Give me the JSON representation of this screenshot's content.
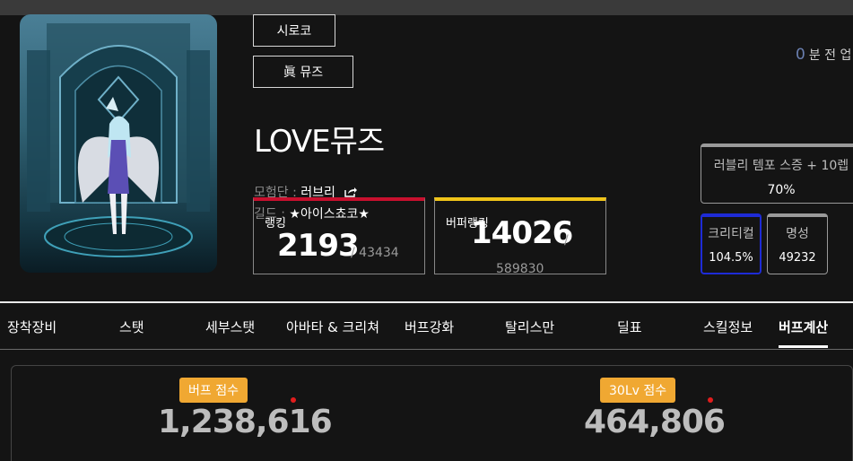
{
  "character": {
    "server": "시로코",
    "job": "眞 뮤즈",
    "name": "LOVE뮤즈",
    "adventure_label": "모험단 : ",
    "adventure_name": "러브리",
    "guild_label": "길드 : ",
    "guild_name": "★아이스쵸코★"
  },
  "updated": {
    "count": "0",
    "text": "분 전 업"
  },
  "ranking": {
    "label": "랭킹",
    "value": "2193",
    "total": "/ 43434"
  },
  "buffer_ranking": {
    "label": "버퍼랭킹",
    "value": "14026",
    "slash": "/",
    "total": "589830"
  },
  "tempo": {
    "label": "러블리 템포 스증 + 10렙",
    "value": "70%"
  },
  "stats": {
    "crit_label": "크리티컬",
    "crit_value": "104.5%",
    "fame_label": "명성",
    "fame_value": "49232"
  },
  "tabs": [
    {
      "label": "장착장비"
    },
    {
      "label": "스탯"
    },
    {
      "label": "세부스탯"
    },
    {
      "label": "아바타 & 크리쳐"
    },
    {
      "label": "버프강화"
    },
    {
      "label": "탈리스만"
    },
    {
      "label": "딜표"
    },
    {
      "label": "스킬정보"
    },
    {
      "label": "버프계산"
    }
  ],
  "scores": {
    "buff_label": "버프 점수",
    "buff_value": "1,238,616",
    "lv30_label": "30Lv 점수",
    "lv30_value": "464,806"
  },
  "colors": {
    "ranking_accent": "#c8102e",
    "buffer_ranking_accent": "#f0c419",
    "crit_border": "#1e2bd6",
    "badge": "#f0a832",
    "dot": "#e11d1d"
  }
}
